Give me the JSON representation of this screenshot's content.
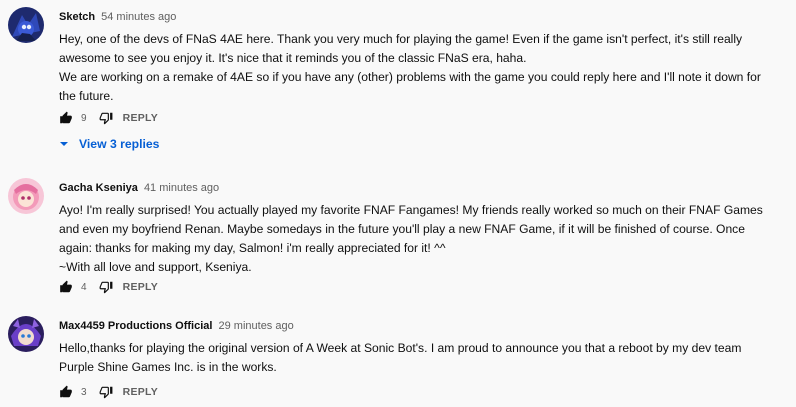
{
  "comments": [
    {
      "author": "Sketch",
      "time": "54 minutes ago",
      "text": "Hey, one of the devs of FNaS 4AE here. Thank you very much for playing the game! Even if the game isn't perfect, it's still really\nawesome to see you enjoy it. It's nice that it reminds you of the classic FNaS era, haha.\nWe are working on a remake of 4AE so if you have any (other) problems with the game you could reply here and I'll note it down for\nthe future.",
      "likes": "9",
      "reply_label": "REPLY",
      "view_replies": "View 3 replies",
      "avatar_color": "#2a3a8c"
    },
    {
      "author": "Gacha Kseniya",
      "time": "41 minutes ago",
      "text": "Ayo! I'm really surprised! You actually played my favorite FNAF Fangames! My friends really worked so much on their FNAF Games\nand even my boyfriend Renan. Maybe somedays in the future you'll play a new FNAF Game, if it will be finished of course. Once\nagain: thanks for making my day, Salmon! i'm really appreciated for it! ^^\n~With all love and support, Kseniya.",
      "likes": "4",
      "reply_label": "REPLY",
      "avatar_color": "#f3a6c3"
    },
    {
      "author": "Max4459 Productions Official",
      "time": "29 minutes ago",
      "text": "Hello,thanks for playing the original version of A Week at Sonic Bot's. I am proud to announce you that a reboot by my dev team\nPurple Shine Games Inc. is in the works.",
      "likes": "3",
      "reply_label": "REPLY",
      "avatar_color": "#3b2a7a"
    }
  ]
}
